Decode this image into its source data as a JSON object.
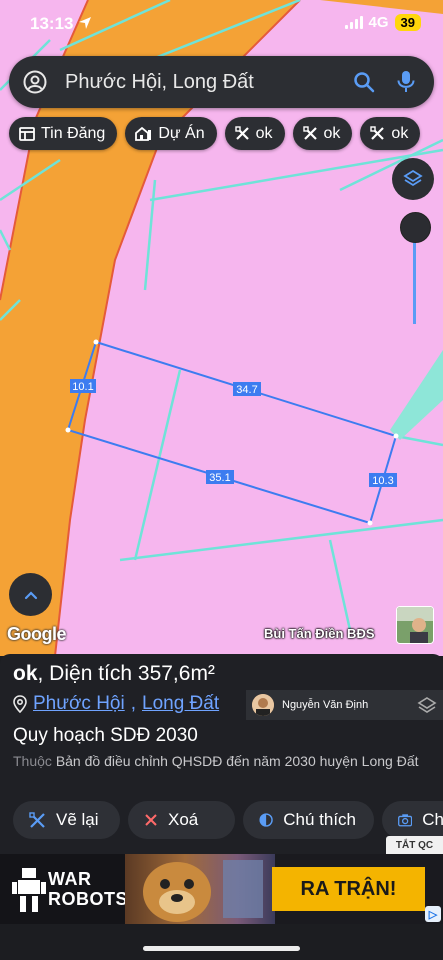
{
  "status_bar": {
    "time": "13:13",
    "network": "4G",
    "battery": "39"
  },
  "search": {
    "query": "Phước Hội, Long Đất"
  },
  "chips": [
    {
      "label": "Tin Đăng",
      "icon": "listing-icon"
    },
    {
      "label": "Dự Án",
      "icon": "project-icon"
    },
    {
      "label": "ok",
      "icon": "tools-icon"
    },
    {
      "label": "ok",
      "icon": "tools-icon"
    },
    {
      "label": "ok",
      "icon": "tools-icon"
    }
  ],
  "map": {
    "measurements": {
      "left": "10.1",
      "top": "34.7",
      "bottom": "35.1",
      "right": "10.3"
    },
    "logo": "Google",
    "watermark": "Bùi Tấn Điền BĐS",
    "colors": {
      "land": "#f6b6ee",
      "road": "#f4a236",
      "parcel_outline": "#3d7cf0",
      "cyan_line": "#6fe3d8"
    }
  },
  "sheet": {
    "title_name": "ok",
    "title_rest": ", Diện tích 357,6m²",
    "location": {
      "ward": "Phước Hội",
      "separator": ",",
      "district": "Long Đất"
    },
    "author": "Nguyễn Văn Định",
    "plan": "Quy hoạch SDĐ 2030",
    "desc_prefix": "Thuộc",
    "desc_text": "Bản đồ điều chỉnh QHSDĐ đến năm 2030 huyện Long Đất"
  },
  "actions": [
    {
      "label": "Vẽ lại",
      "icon": "redraw-icon"
    },
    {
      "label": "Xoá",
      "icon": "close-icon"
    },
    {
      "label": "Chú thích",
      "icon": "legend-icon"
    },
    {
      "label": "Ch",
      "icon": "camera-icon"
    }
  ],
  "ad": {
    "badge": "TẮT QC",
    "brand_line1": "WAR",
    "brand_line2": "ROBOTS",
    "cta": "RA TRẬN!"
  }
}
